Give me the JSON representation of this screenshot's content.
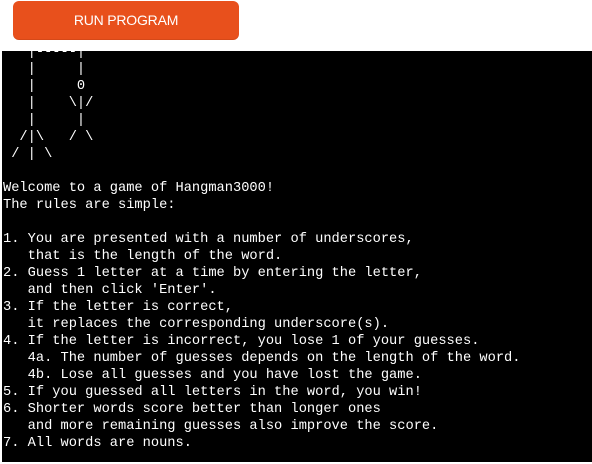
{
  "toolbar": {
    "run_label": "RUN PROGRAM"
  },
  "colors": {
    "run_button": "#e8501c",
    "terminal_bg": "#000000",
    "terminal_text": "#ffffff"
  },
  "terminal": {
    "lines": [
      "   |-----|",
      "   |     |",
      "   |     0",
      "   |    \\|/",
      "   |     |",
      "  /|\\   / \\",
      " / | \\",
      "",
      "Welcome to a game of Hangman3000!",
      "The rules are simple:",
      "",
      "1. You are presented with a number of underscores,",
      "   that is the length of the word.",
      "2. Guess 1 letter at a time by entering the letter,",
      "   and then click 'Enter'.",
      "3. If the letter is correct,",
      "   it replaces the corresponding underscore(s).",
      "4. If the letter is incorrect, you lose 1 of your guesses.",
      "   4a. The number of guesses depends on the length of the word.",
      "   4b. Lose all guesses and you have lost the game.",
      "5. If you guessed all letters in the word, you win!",
      "6. Shorter words score better than longer ones",
      "   and more remaining guesses also improve the score.",
      "7. All words are nouns."
    ]
  }
}
